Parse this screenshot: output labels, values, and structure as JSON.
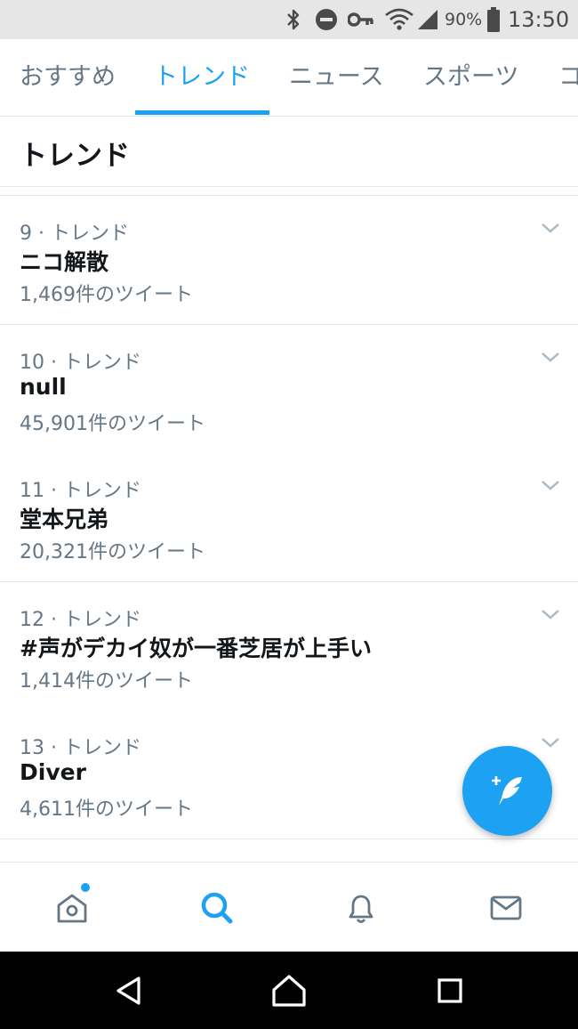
{
  "status_bar": {
    "battery_percent": "90%",
    "time": "13:50",
    "icons": [
      "bluetooth-icon",
      "do-not-disturb-icon",
      "vpn-key-icon",
      "wifi-icon",
      "cellular-signal-icon",
      "battery-icon"
    ]
  },
  "tabs": [
    {
      "label": "おすすめ",
      "active": false
    },
    {
      "label": "トレンド",
      "active": true
    },
    {
      "label": "ニュース",
      "active": false
    },
    {
      "label": "スポーツ",
      "active": false
    },
    {
      "label": "コ",
      "active": false
    }
  ],
  "section": {
    "title": "トレンド"
  },
  "trends": [
    {
      "meta": "9 · トレンド",
      "name": "ニコ解散",
      "count": "1,469件のツイート"
    },
    {
      "meta": "10 · トレンド",
      "name": "null",
      "count": "45,901件のツイート"
    },
    {
      "meta": "11 · トレンド",
      "name": "堂本兄弟",
      "count": "20,321件のツイート"
    },
    {
      "meta": "12 · トレンド",
      "name": "#声がデカイ奴が一番芝居が上手い",
      "count": "1,414件のツイート"
    },
    {
      "meta": "13 · トレンド",
      "name": "Diver",
      "count": "4,611件のツイート"
    }
  ],
  "fab": {
    "icon": "compose-tweet-icon"
  },
  "bottom_nav": [
    {
      "icon": "home-icon",
      "active": false,
      "has_dot": true
    },
    {
      "icon": "search-icon",
      "active": true,
      "has_dot": false
    },
    {
      "icon": "notifications-bell-icon",
      "active": false,
      "has_dot": false
    },
    {
      "icon": "messages-envelope-icon",
      "active": false,
      "has_dot": false
    }
  ],
  "android_nav": [
    "back-icon",
    "home-circle-icon",
    "recents-square-icon"
  ],
  "colors": {
    "accent": "#1da1f2",
    "text_primary": "#14171a",
    "text_secondary": "#657786",
    "divider": "#e1e8ed"
  }
}
